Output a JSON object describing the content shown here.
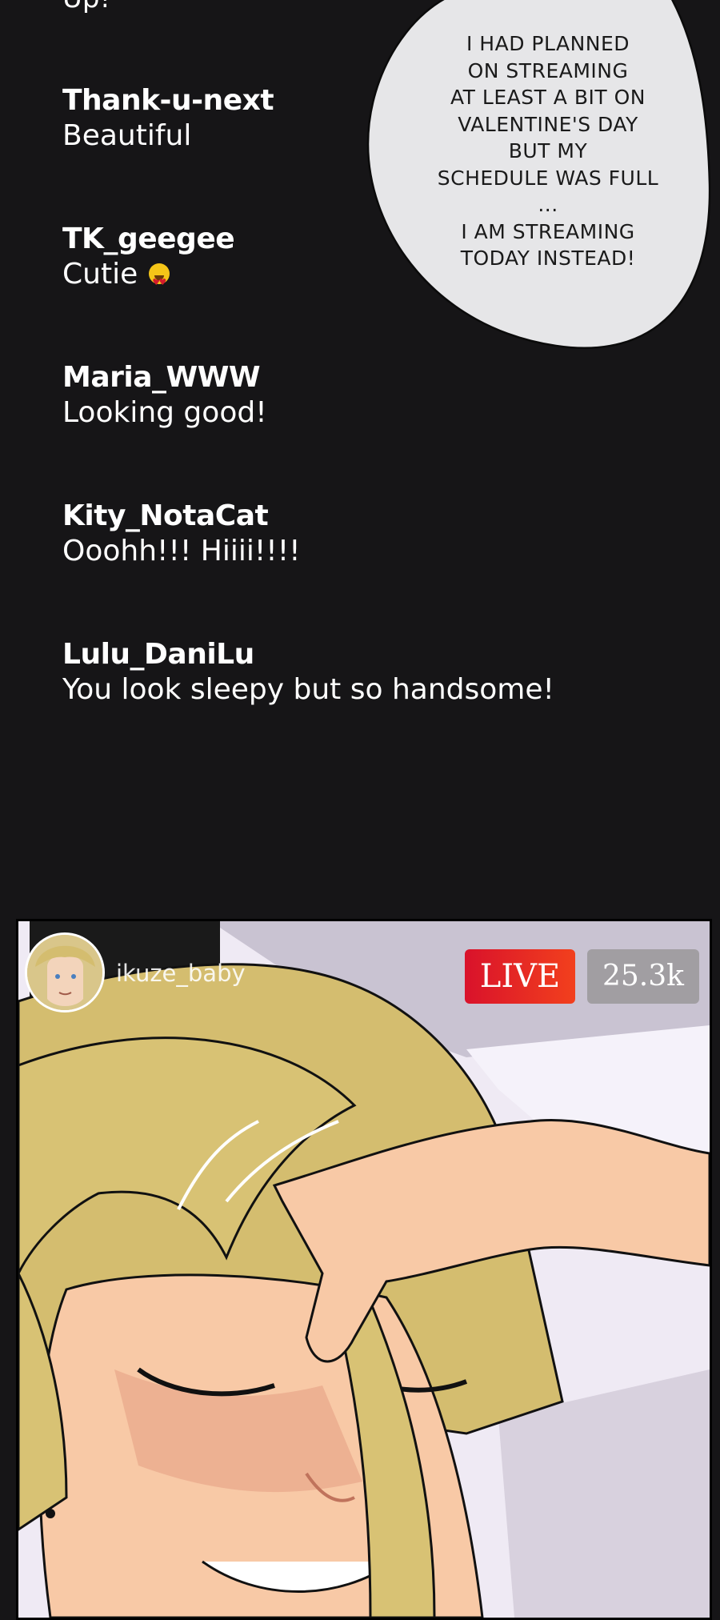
{
  "chat": {
    "top_fragment": "Up!",
    "messages": [
      {
        "user": "Thank-u-next",
        "text": "Beautiful"
      },
      {
        "user": "TK_geegee",
        "text": "Cutie",
        "emoji": "heart-eyes-emoji"
      },
      {
        "user": "Maria_WWW",
        "text": "Looking good!"
      },
      {
        "user": "Kity_NotaCat",
        "text": "Ooohh!!! Hiiii!!!!"
      },
      {
        "user": "Lulu_DaniLu",
        "text": "You look sleepy but so handsome!"
      }
    ]
  },
  "speech_bubble": {
    "lines": [
      "I HAD PLANNED",
      "ON STREAMING",
      "AT LEAST A BIT ON",
      "VALENTINE'S DAY",
      "BUT MY",
      "SCHEDULE WAS FULL",
      "...",
      "I AM STREAMING",
      "TODAY INSTEAD!"
    ]
  },
  "stream": {
    "username": "ikuze_baby",
    "live_label": "LIVE",
    "viewer_count": "25.3k"
  },
  "colors": {
    "background": "#161517",
    "live_red": "#e8242a",
    "viewer_gray": "#a19ea2",
    "hair": "#d4bd6f",
    "skin": "#f8c9a6"
  }
}
